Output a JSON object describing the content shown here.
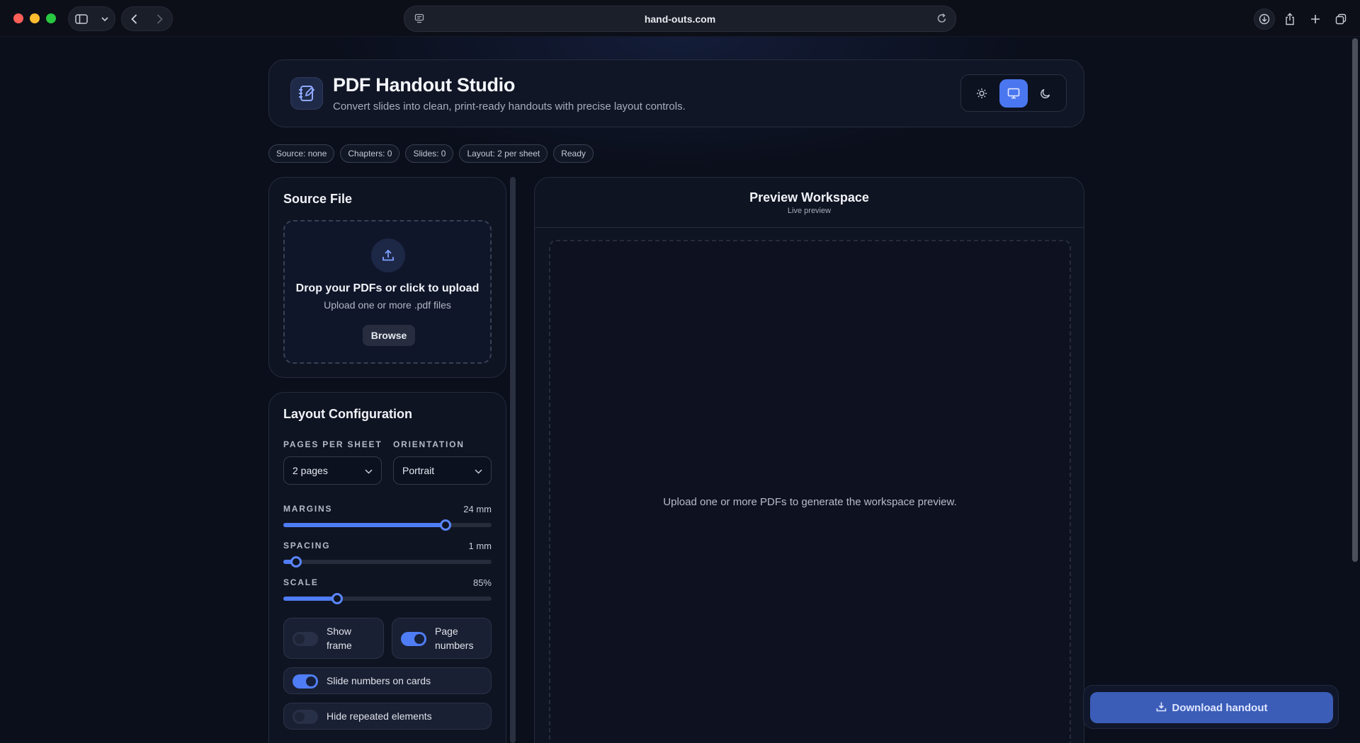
{
  "browser": {
    "url": "hand-outs.com",
    "icons": [
      "sidebar-icon",
      "chevron-down-icon",
      "back-icon",
      "forward-icon",
      "page-settings-icon",
      "reload-icon",
      "download-icon",
      "share-icon",
      "new-tab-icon",
      "tabs-overview-icon"
    ]
  },
  "header": {
    "title": "PDF Handout Studio",
    "subtitle": "Convert slides into clean, print-ready handouts with precise layout controls.",
    "theme_modes": [
      "light",
      "system",
      "dark"
    ],
    "active_theme": "system"
  },
  "status": {
    "source": "Source: none",
    "chapters": "Chapters: 0",
    "slides": "Slides: 0",
    "layout": "Layout: 2 per sheet",
    "state": "Ready"
  },
  "source_card": {
    "title": "Source File",
    "drop_title": "Drop your PDFs or click to upload",
    "drop_sub": "Upload one or more .pdf files",
    "browse_label": "Browse"
  },
  "layout_card": {
    "title": "Layout Configuration",
    "pages_per_sheet_label": "PAGES PER SHEET",
    "pages_per_sheet_value": "2 pages",
    "orientation_label": "ORIENTATION",
    "orientation_value": "Portrait",
    "margins_label": "MARGINS",
    "margins_value": "24 mm",
    "margins_fraction": 0.78,
    "spacing_label": "SPACING",
    "spacing_value": "1 mm",
    "spacing_fraction": 0.06,
    "scale_label": "SCALE",
    "scale_value": "85%",
    "scale_fraction": 0.26,
    "toggles": {
      "show_frame": {
        "label": "Show frame",
        "on": false
      },
      "page_numbers": {
        "label": "Page numbers",
        "on": true
      },
      "slide_numbers": {
        "label": "Slide numbers on cards",
        "on": true
      },
      "hide_repeated": {
        "label": "Hide repeated elements",
        "on": false
      }
    }
  },
  "preview": {
    "title": "Preview Workspace",
    "subtitle": "Live preview",
    "empty_message": "Upload one or more PDFs to generate the workspace preview."
  },
  "download": {
    "label": "Download handout"
  },
  "colors": {
    "accent": "#4f7df5",
    "background": "#0b0f1c",
    "card": "#0f1422"
  }
}
